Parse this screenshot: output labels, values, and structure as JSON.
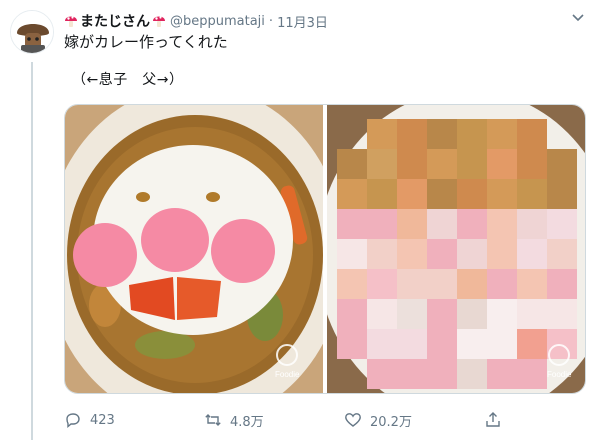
{
  "tweet": {
    "display_name": "またじさん",
    "handle": "@beppumataji",
    "separator": "·",
    "date": "11月3日",
    "text": "嫁がカレー作ってくれた",
    "subtext": "（←息子　父→）",
    "media": {
      "left_watermark": "Foodie",
      "right_watermark": "Foodie"
    },
    "actions": {
      "replies": "423",
      "retweets": "4.8万",
      "likes": "20.2万"
    }
  },
  "colors": {
    "accent_red": "#e0245e",
    "muted": "#657786",
    "border": "#cfd9de"
  },
  "icons": [
    "mushroom-icon",
    "more-icon",
    "reply-icon",
    "retweet-icon",
    "like-icon",
    "share-icon"
  ]
}
